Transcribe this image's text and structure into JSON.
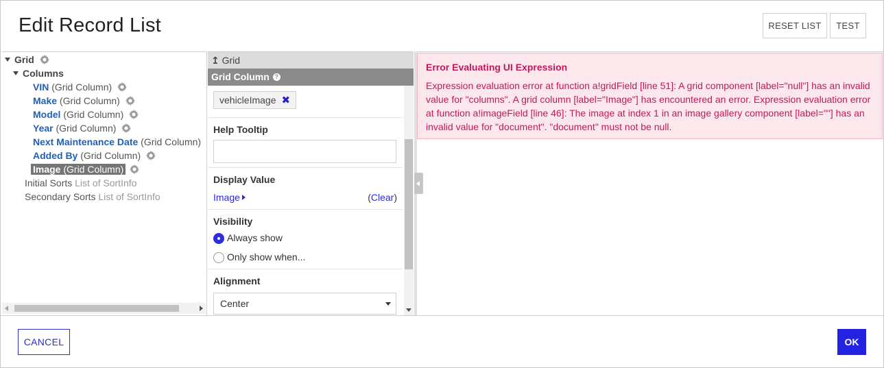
{
  "dialog": {
    "title": "Edit Record List",
    "reset_label": "RESET LIST",
    "test_label": "TEST"
  },
  "tree": {
    "root": "Grid",
    "columns_label": "Columns",
    "items": [
      {
        "name": "VIN",
        "type": "(Grid Column)"
      },
      {
        "name": "Make",
        "type": "(Grid Column)"
      },
      {
        "name": "Model",
        "type": "(Grid Column)"
      },
      {
        "name": "Year",
        "type": "(Grid Column)"
      },
      {
        "name": "Next Maintenance Date",
        "type": "(Grid Column)"
      },
      {
        "name": "Added By",
        "type": "(Grid Column)"
      },
      {
        "name": "Image",
        "type": "(Grid Column)",
        "selected": true
      }
    ],
    "initial_sorts_label": "Initial Sorts",
    "initial_sorts_type": "List of SortInfo",
    "secondary_sorts_label": "Secondary Sorts",
    "secondary_sorts_type": "List of SortInfo"
  },
  "config": {
    "breadcrumb": "Grid",
    "header": "Grid Column",
    "header_help_icon": "?",
    "field_pill": "vehicleImage",
    "help_tooltip_label": "Help Tooltip",
    "help_tooltip_value": "",
    "display_value_label": "Display Value",
    "display_value_link": "Image",
    "clear_open": "(",
    "clear_label": "Clear",
    "clear_close": ")",
    "visibility_label": "Visibility",
    "visibility_options": [
      "Always show",
      "Only show when..."
    ],
    "visibility_selected": "Always show",
    "alignment_label": "Alignment",
    "alignment_value": "Center"
  },
  "preview": {
    "error_title": "Error Evaluating UI Expression",
    "error_text": "Expression evaluation error at function a!gridField [line 51]: A grid component [label=\"null\"] has an invalid value for \"columns\". A grid column [label=\"Image\"] has encountered an error. Expression evaluation error at function a!imageField [line 46]: The image at index 1 in an image gallery component [label=\"\"] has an invalid value for \"document\". \"document\" must not be null."
  },
  "footer": {
    "cancel_label": "CANCEL",
    "ok_label": "OK"
  },
  "colors": {
    "accent": "#2222e0",
    "link": "#2160b8",
    "error_text": "#c2185b",
    "error_bg": "#fce8ec"
  }
}
